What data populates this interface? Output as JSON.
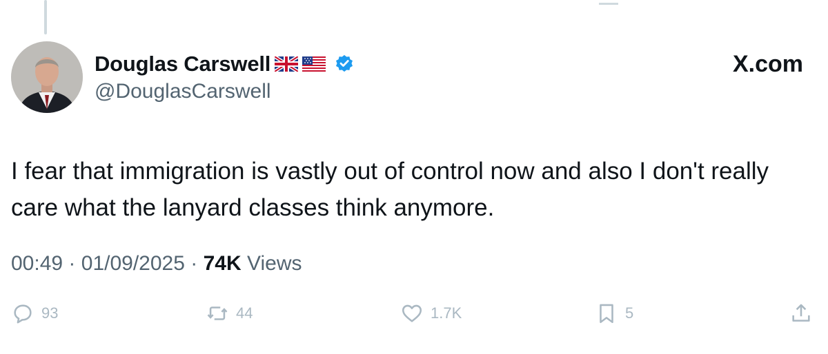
{
  "author": {
    "display_name": "Douglas Carswell",
    "handle": "@DouglasCarswell",
    "flags": [
      "uk-flag-icon",
      "us-flag-icon"
    ],
    "verified_icon": "verified-badge-icon"
  },
  "brand": "X.com",
  "tweet": {
    "text": "I fear that immigration is vastly out of control now and also I don't really care what the lanyard classes think anymore."
  },
  "meta": {
    "time": "00:49",
    "date": "01/09/2025",
    "views_count": "74K",
    "views_label": "Views",
    "separator": "·"
  },
  "actions": {
    "replies": "93",
    "reposts": "44",
    "likes": "1.7K",
    "bookmarks": "5"
  },
  "colors": {
    "text": "#0f1419",
    "secondary": "#536471",
    "verified": "#1d9bf0",
    "faded_icons": "#aab8c2"
  }
}
